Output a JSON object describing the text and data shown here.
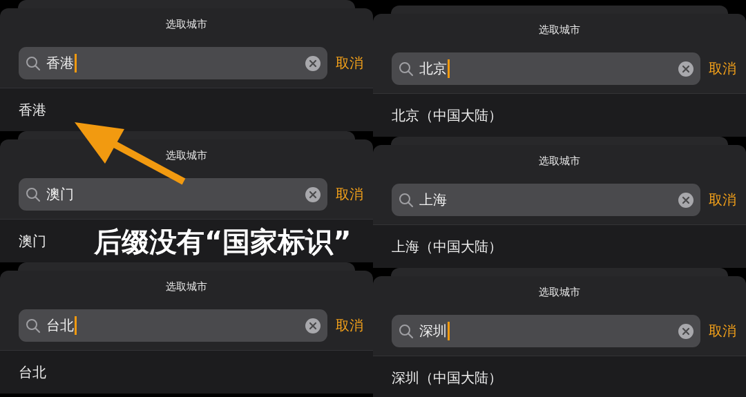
{
  "left_column": [
    {
      "title": "选取城市",
      "search": {
        "value": "香港",
        "focused": true
      },
      "cancel": "取消",
      "result": "香港"
    },
    {
      "title": "选取城市",
      "search": {
        "value": "澳门",
        "focused": false
      },
      "cancel": "取消",
      "result": "澳门"
    },
    {
      "title": "选取城市",
      "search": {
        "value": "台北",
        "focused": true
      },
      "cancel": "取消",
      "result": "台北"
    }
  ],
  "right_column": [
    {
      "title": "选取城市",
      "search": {
        "value": "北京",
        "focused": true
      },
      "cancel": "取消",
      "result": "北京（中国大陆）"
    },
    {
      "title": "选取城市",
      "search": {
        "value": "上海",
        "focused": false
      },
      "cancel": "取消",
      "result": "上海（中国大陆）"
    },
    {
      "title": "选取城市",
      "search": {
        "value": "深圳",
        "focused": true
      },
      "cancel": "取消",
      "result": "深圳（中国大陆）"
    }
  ],
  "annotation": {
    "text": "后缀没有“国家标识”"
  }
}
